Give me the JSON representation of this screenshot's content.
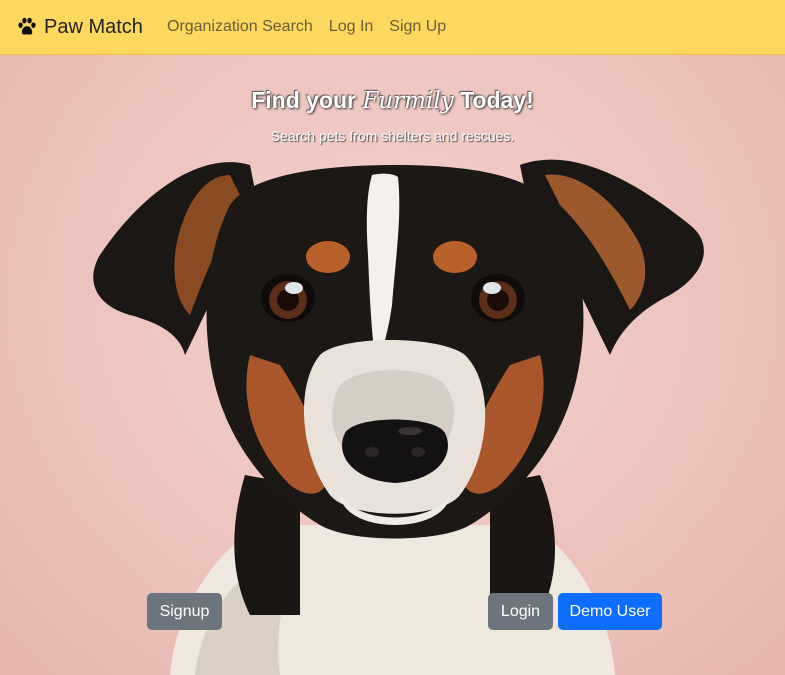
{
  "navbar": {
    "brand": "Paw Match",
    "brand_icon": "paw-icon",
    "links": [
      "Organization Search",
      "Log In",
      "Sign Up"
    ],
    "background": "#fcd95e"
  },
  "hero": {
    "headline_before": "Find your",
    "headline_script": "Furmily",
    "headline_after": "Today!",
    "subtext": "Search pets from shelters and rescues.",
    "buttons": {
      "signup": "Signup",
      "login": "Login",
      "demo": "Demo User"
    },
    "image": "dog-photo"
  },
  "colors": {
    "secondary_button": "#6c757d",
    "primary_button": "#0d6efd"
  }
}
